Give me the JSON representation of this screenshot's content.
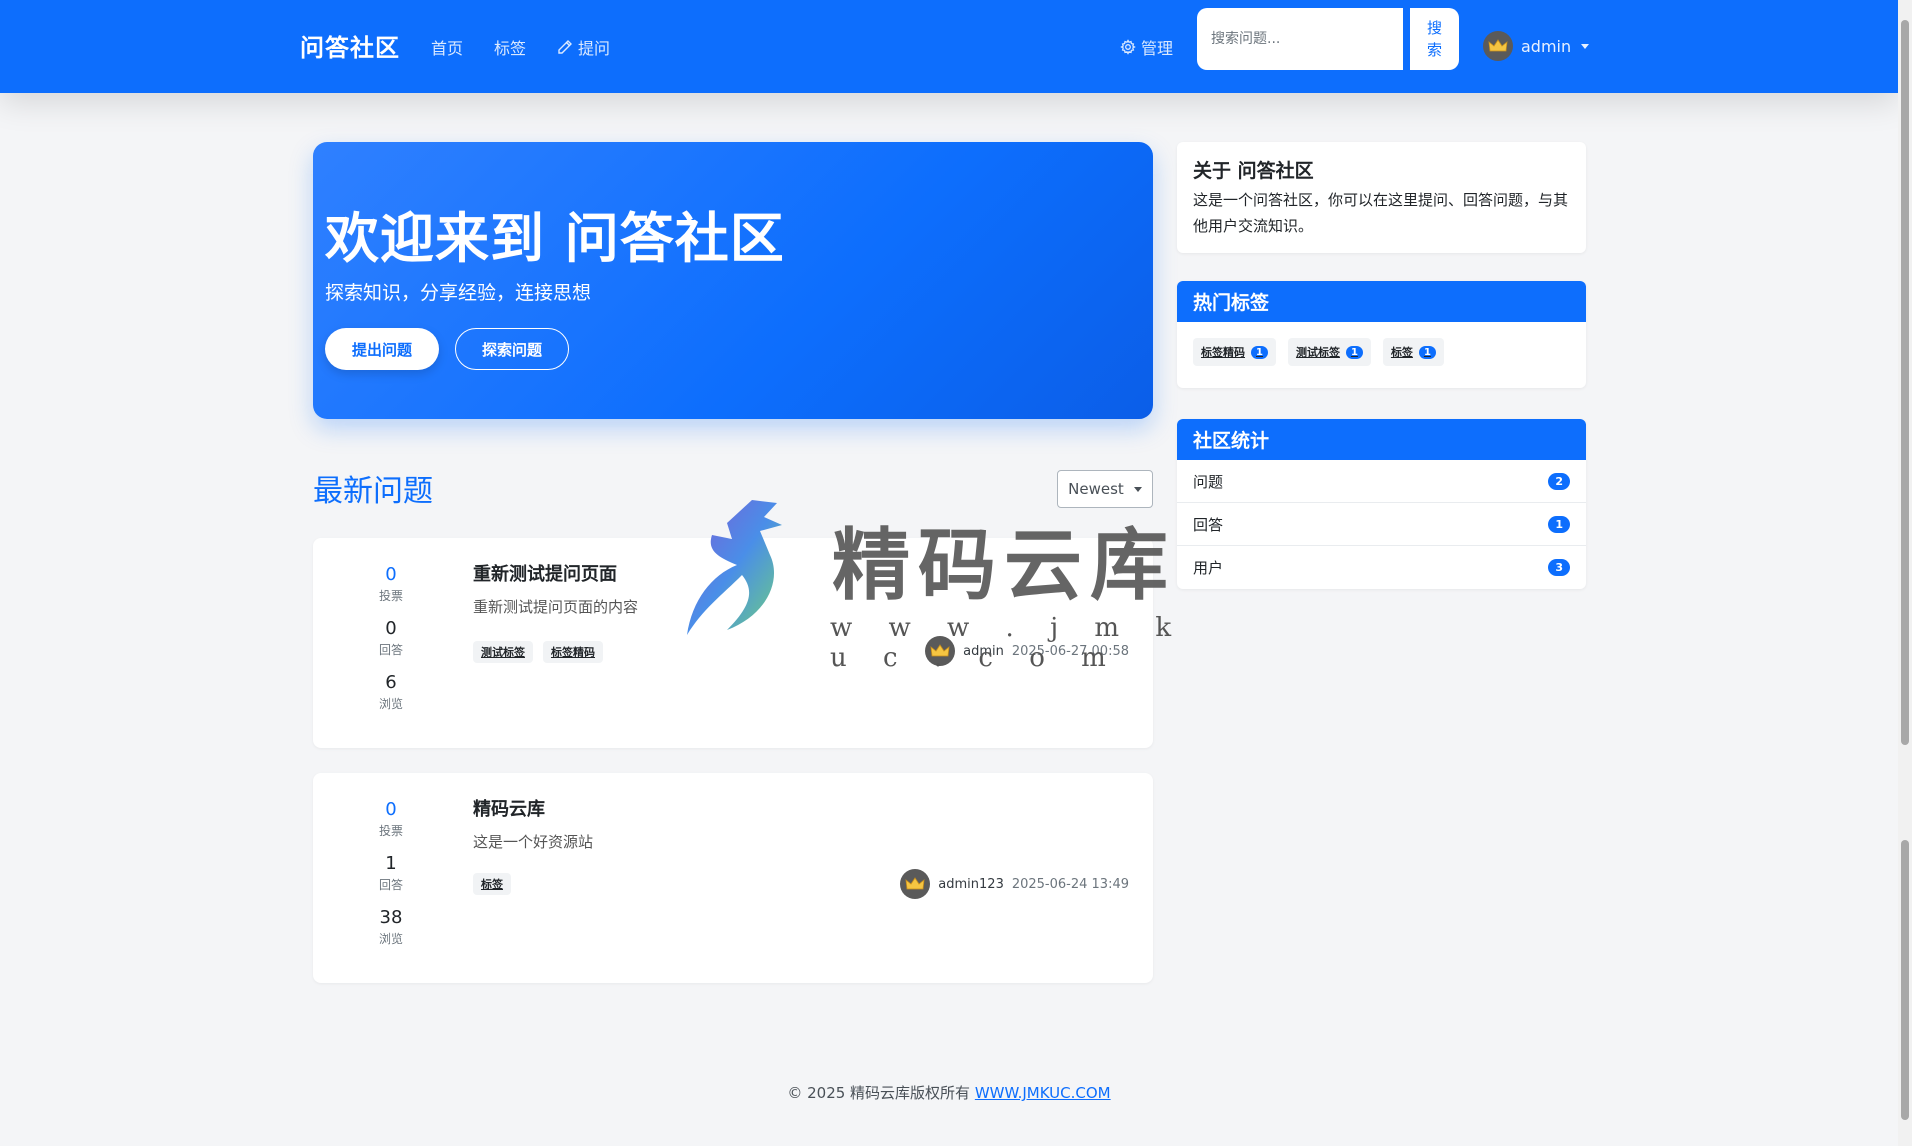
{
  "navbar": {
    "brand": "问答社区",
    "links": [
      {
        "label": "首页",
        "icon": ""
      },
      {
        "label": "标签",
        "icon": ""
      },
      {
        "label": "提问",
        "icon": "pencil-icon"
      }
    ],
    "admin_label": "管理",
    "search_placeholder": "搜索问题...",
    "search_button": "搜\n索",
    "user": "admin"
  },
  "hero": {
    "title": "欢迎来到 问答社区",
    "subtitle": "探索知识，分享经验，连接思想",
    "primary_button": "提出问题",
    "secondary_button": "探索问题"
  },
  "questions_section": {
    "title": "最新问题",
    "sort_selected": "Newest"
  },
  "questions": [
    {
      "votes": "0",
      "votes_label": "投票",
      "answers": "0",
      "answers_label": "回答",
      "views": "6",
      "views_label": "浏览",
      "title": "重新测试提问页面",
      "excerpt": "重新测试提问页面的内容",
      "tags": [
        "测试标签",
        "标签精码"
      ],
      "author": "admin",
      "time": "2025-06-27 00:58"
    },
    {
      "votes": "0",
      "votes_label": "投票",
      "answers": "1",
      "answers_label": "回答",
      "views": "38",
      "views_label": "浏览",
      "title": "精码云库",
      "excerpt": "这是一个好资源站",
      "tags": [
        "标签"
      ],
      "author": "admin123",
      "time": "2025-06-24 13:49"
    }
  ],
  "sidebar": {
    "about": {
      "title": "关于 问答社区",
      "text": "这是一个问答社区，你可以在这里提问、回答问题，与其他用户交流知识。"
    },
    "hot_tags": {
      "title": "热门标签",
      "tags": [
        {
          "name": "标签精码",
          "count": "1"
        },
        {
          "name": "测试标签",
          "count": "1"
        },
        {
          "name": "标签",
          "count": "1"
        }
      ]
    },
    "stats": {
      "title": "社区统计",
      "rows": [
        {
          "label": "问题",
          "count": "2"
        },
        {
          "label": "回答",
          "count": "1"
        },
        {
          "label": "用户",
          "count": "3"
        }
      ]
    }
  },
  "footer": {
    "text": "© 2025 精码云库版权所有",
    "link": "WWW.JMKUC.COM"
  },
  "watermark": {
    "text": "精码云库",
    "url": "w w w . j m k u c . c o m"
  },
  "colors": {
    "primary": "#0d6efd",
    "background": "#f4f5f7"
  }
}
